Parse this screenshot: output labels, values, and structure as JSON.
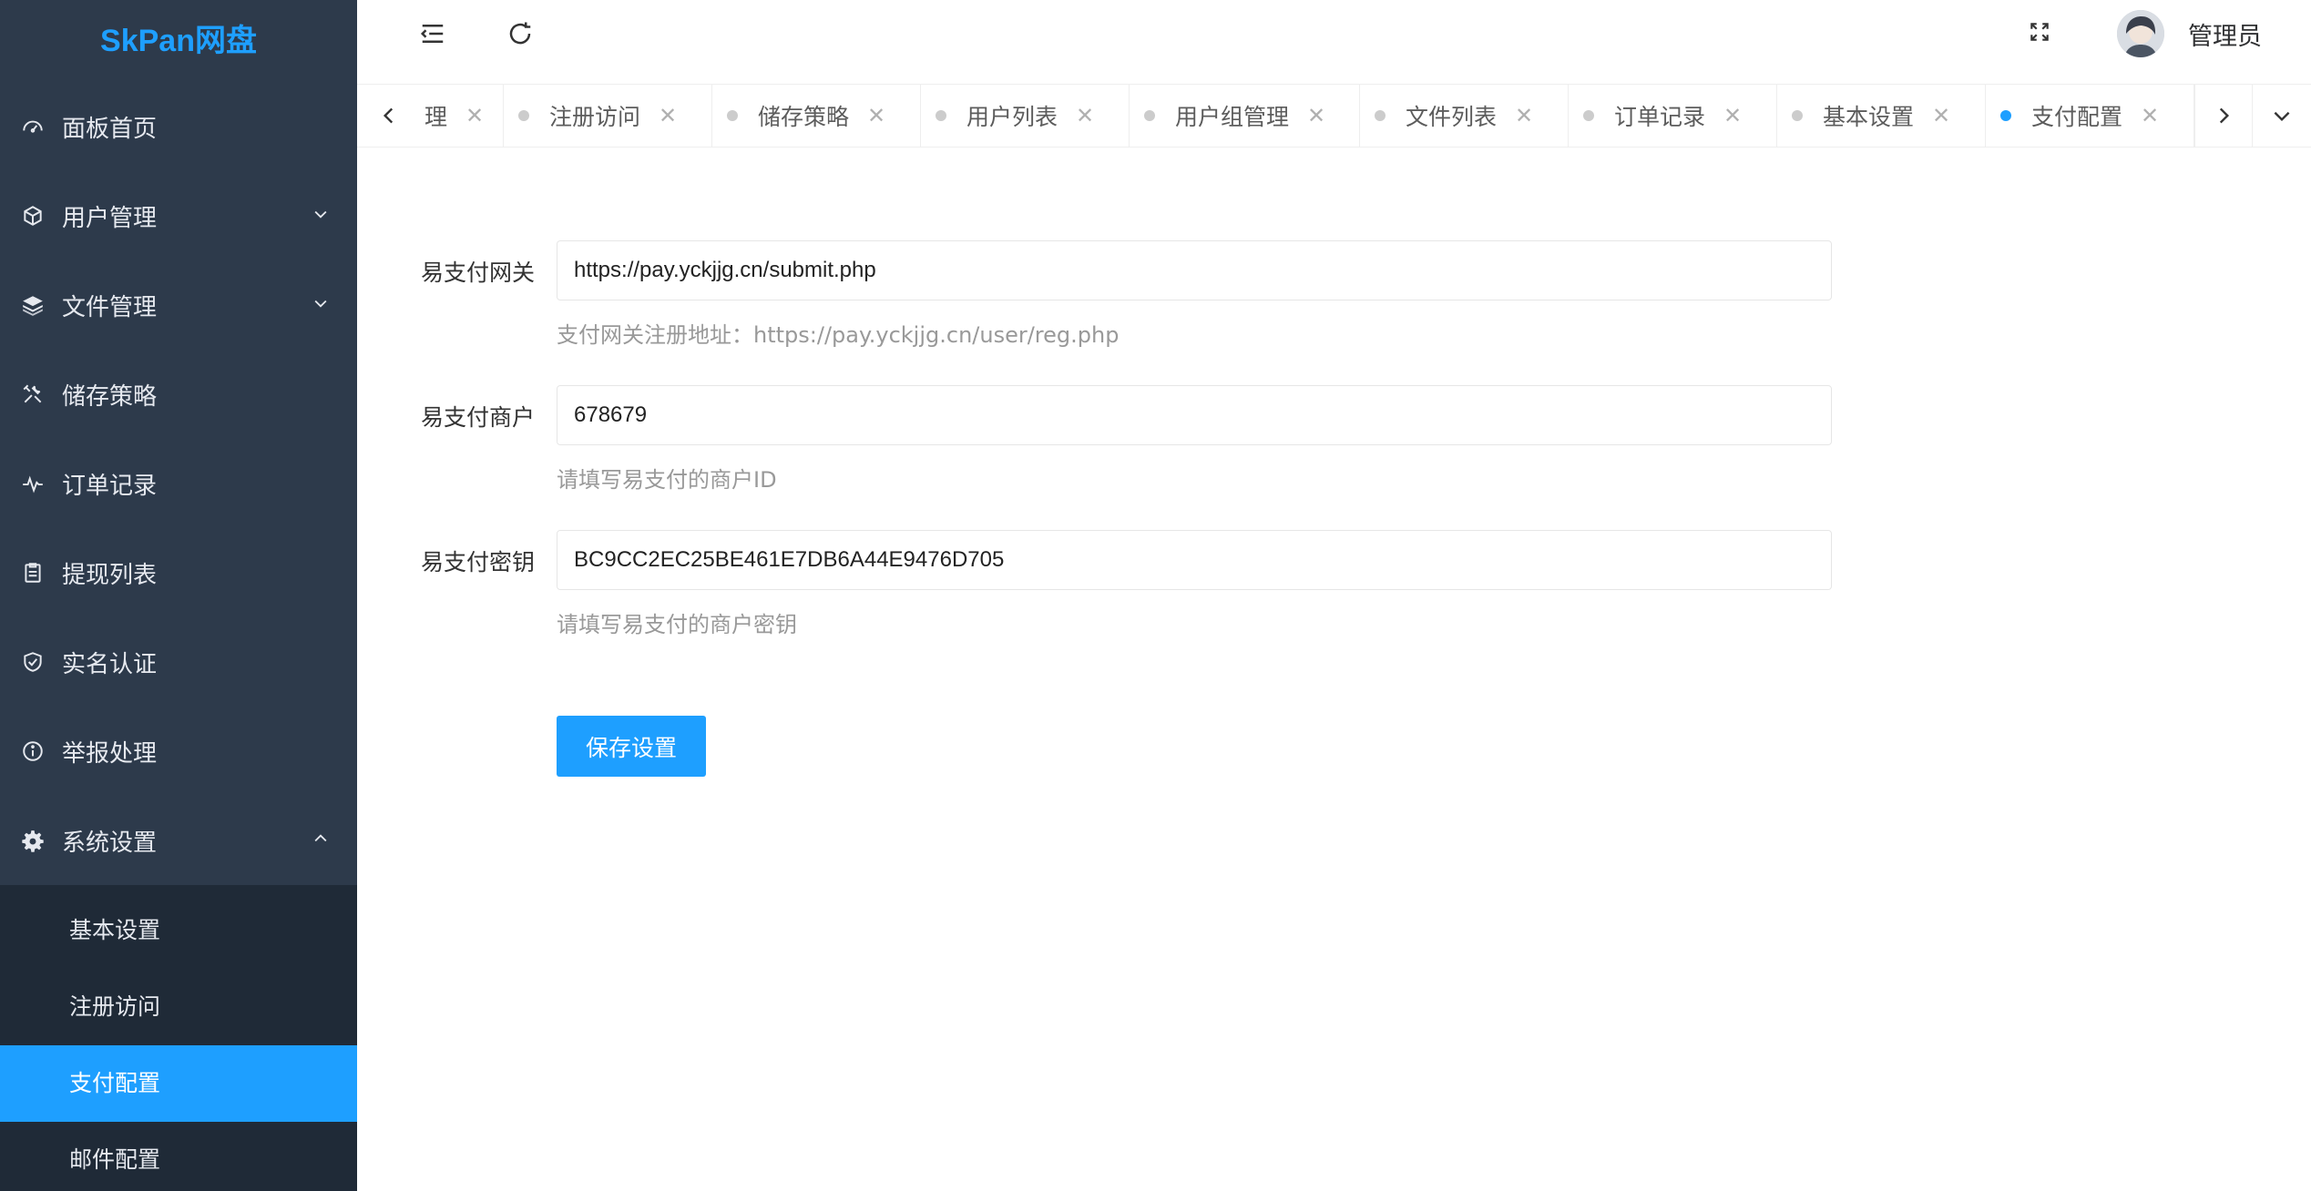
{
  "app": {
    "logo": "SkPan网盘"
  },
  "sidebar": {
    "items": [
      {
        "label": "面板首页",
        "icon": "dashboard-icon"
      },
      {
        "label": "用户管理",
        "icon": "cube-icon",
        "expandable": true
      },
      {
        "label": "文件管理",
        "icon": "layers-icon",
        "expandable": true
      },
      {
        "label": "储存策略",
        "icon": "tools-icon"
      },
      {
        "label": "订单记录",
        "icon": "pulse-icon"
      },
      {
        "label": "提现列表",
        "icon": "clipboard-icon"
      },
      {
        "label": "实名认证",
        "icon": "shield-check-icon"
      },
      {
        "label": "举报处理",
        "icon": "info-circle-icon"
      },
      {
        "label": "系统设置",
        "icon": "gear-icon",
        "expanded": true
      }
    ],
    "subitems": [
      {
        "label": "基本设置"
      },
      {
        "label": "注册访问"
      },
      {
        "label": "支付配置",
        "active": true
      },
      {
        "label": "邮件配置"
      }
    ]
  },
  "header": {
    "username": "管理员"
  },
  "tabs": [
    {
      "label": "理"
    },
    {
      "label": "注册访问"
    },
    {
      "label": "储存策略"
    },
    {
      "label": "用户列表"
    },
    {
      "label": "用户组管理"
    },
    {
      "label": "文件列表"
    },
    {
      "label": "订单记录"
    },
    {
      "label": "基本设置"
    },
    {
      "label": "支付配置",
      "active": true
    }
  ],
  "form": {
    "gateway": {
      "label": "易支付网关",
      "value": "https://pay.yckjjg.cn/submit.php",
      "help": "支付网关注册地址：https://pay.yckjjg.cn/user/reg.php"
    },
    "merchant": {
      "label": "易支付商户",
      "value": "678679",
      "help": "请填写易支付的商户ID"
    },
    "secret": {
      "label": "易支付密钥",
      "value": "BC9CC2EC25BE461E7DB6A44E9476D705",
      "help": "请填写易支付的商户密钥"
    },
    "save_label": "保存设置"
  },
  "colors": {
    "accent": "#1e9fff",
    "sidebar_bg": "#2d3a4b",
    "submenu_bg": "#1f2a37"
  }
}
